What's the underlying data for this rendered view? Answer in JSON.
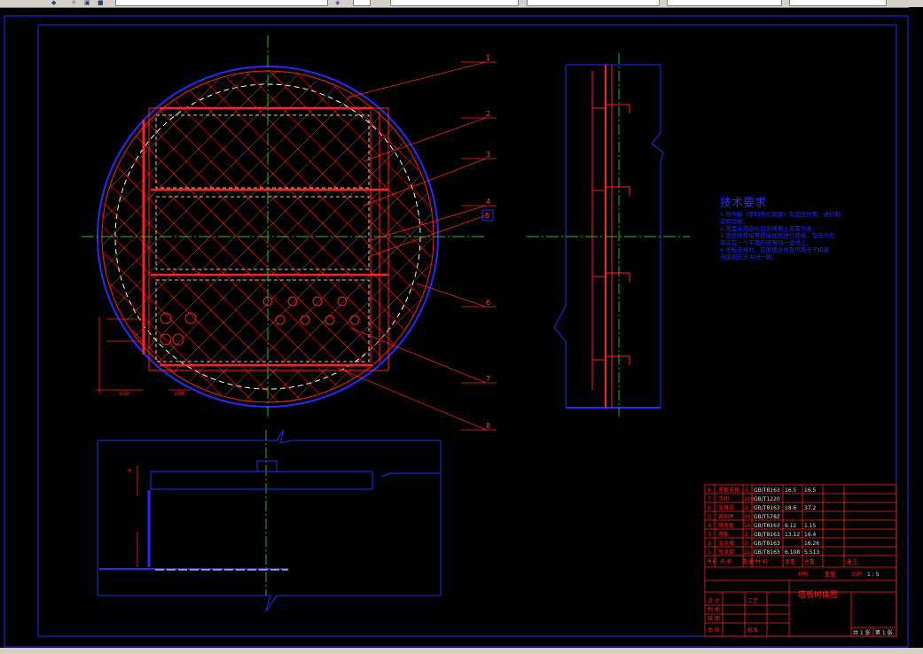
{
  "app": {
    "toolbar_fields": [
      "",
      "",
      "",
      "",
      ""
    ],
    "status_text": ""
  },
  "drawing": {
    "title": "塔板树体图",
    "callouts": [
      "1",
      "2",
      "3",
      "4",
      "5",
      "6",
      "7",
      "8"
    ],
    "tech_requirements": {
      "title": "技术要求",
      "lines": [
        "1.塔件板《钢制塔式容器》及受压件图，进行制",
        "造和验收。",
        "2.塔盘采用自检后支撑圈上无需为准。",
        "3.受压件焊接等焊接规程进行焊接，受压件应",
        "保证在一个平面的容差同一直线上。",
        "4.塔板连接时，应图组合件及可用卡子扣紧",
        "连接后应无关闭一致。"
      ]
    },
    "bom": {
      "rows": [
        [
          "8",
          "塔板支撑",
          "2",
          "GB/T8163",
          "16.5",
          "16.5",
          ""
        ],
        [
          "7",
          "浮阀",
          "108",
          "GB/T1220",
          "",
          "",
          ""
        ],
        [
          "6",
          "支撑梁",
          "2",
          "GB/T8163",
          "18.6",
          "37.2",
          ""
        ],
        [
          "5",
          "紧固件",
          "36",
          "GB/T5782",
          "",
          "",
          ""
        ],
        [
          "4",
          "降液板",
          "56",
          "GB/T8163",
          "6.12",
          "1.15",
          ""
        ],
        [
          "3",
          "塔板",
          "2",
          "GB/T8163",
          "13.12",
          "16.4",
          ""
        ],
        [
          "2",
          "溢流堰",
          "2",
          "GB/T8163",
          "",
          "16.26",
          ""
        ],
        [
          "1",
          "受液盘",
          "11",
          "GB/T8163",
          "6.108",
          "5.513",
          ""
        ]
      ],
      "header": [
        "序号",
        "名  称",
        "数量",
        "材  料",
        "单重",
        "总重",
        "备注"
      ],
      "right_notes": [
        "材料",
        "重量",
        "比例"
      ],
      "part_label": "塔板树体图",
      "sign_rows": [
        "设 计",
        "制 图",
        "描 图",
        "审 核",
        "工艺",
        "批准"
      ],
      "sheet": "第 1 张",
      "sheets_total": "共 1 张",
      "scale": "1 : 5"
    },
    "dims": {
      "d1": "150",
      "d2": "150",
      "d3": "100",
      "d4": "4"
    }
  }
}
